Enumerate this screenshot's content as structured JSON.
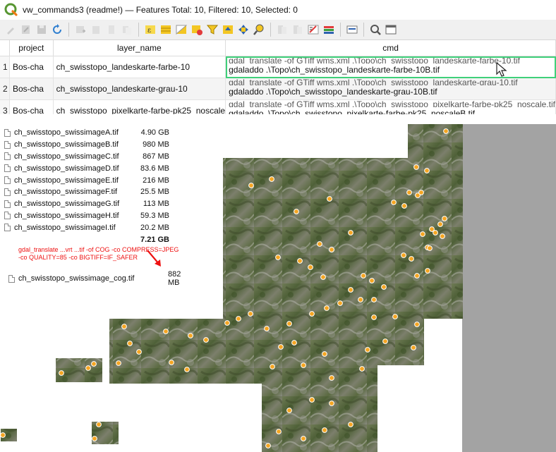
{
  "window": {
    "title": "vw_commands3 (readme!) — Features Total: 10, Filtered: 10, Selected: 0"
  },
  "toolbar": {
    "icons": [
      "pencil-icon",
      "multi-edit-icon",
      "save-icon",
      "reload-icon",
      "add-feature-icon",
      "delete-icon",
      "cut-icon",
      "copy-icon",
      "paste-icon",
      "select-expression-icon",
      "select-all-icon",
      "invert-selection-icon",
      "deselect-icon",
      "filter-icon",
      "move-top-icon",
      "pan-map-icon",
      "zoom-map-icon",
      "new-field-icon",
      "delete-field-icon",
      "field-calculator-icon",
      "conditional-format-icon",
      "dock-icon",
      "actions-icon",
      "form-view-icon"
    ]
  },
  "table": {
    "headers": [
      "project",
      "layer_name",
      "cmd"
    ],
    "rows": [
      {
        "num": "1",
        "project": "Bos-cha",
        "layer_name": "ch_swisstopo_landeskarte-farbe-10",
        "cmd_line1": "gdal_translate -of GTiff wms.xml .\\Topo\\ch_swisstopo_landeskarte-farbe-10.tif",
        "cmd_line2": "gdaladdo .\\Topo\\ch_swisstopo_landeskarte-farbe-10B.tif"
      },
      {
        "num": "2",
        "project": "Bos-cha",
        "layer_name": "ch_swisstopo_landeskarte-grau-10",
        "cmd_line1": "gdal_translate -of GTiff wms.xml .\\Topo\\ch_swisstopo_landeskarte-grau-10.tif",
        "cmd_line2": "gdaladdo .\\Topo\\ch_swisstopo_landeskarte-grau-10B.tif"
      },
      {
        "num": "3",
        "project": "Bos-cha",
        "layer_name": "ch_swisstopo_pixelkarte-farbe-pk25_noscale",
        "cmd_line1": "gdal_translate -of GTiff wms.xml .\\Topo\\ch_swisstopo_pixelkarte-farbe-pk25_noscale.tif",
        "cmd_line2": "gdaladdo .\\Topo\\ch_swisstopo_pixelkarte-farbe-pk25_noscaleB.tif"
      }
    ]
  },
  "files": [
    {
      "name": "ch_swisstopo_swissimageA.tif",
      "size": "4.90 GB"
    },
    {
      "name": "ch_swisstopo_swissimageB.tif",
      "size": "980 MB"
    },
    {
      "name": "ch_swisstopo_swissimageC.tif",
      "size": "867 MB"
    },
    {
      "name": "ch_swisstopo_swissimageD.tif",
      "size": "83.6 MB"
    },
    {
      "name": "ch_swisstopo_swissimageE.tif",
      "size": "216 MB"
    },
    {
      "name": "ch_swisstopo_swissimageF.tif",
      "size": "25.5 MB"
    },
    {
      "name": "ch_swisstopo_swissimageG.tif",
      "size": "113 MB"
    },
    {
      "name": "ch_swisstopo_swissimageH.tif",
      "size": "59.3 MB"
    },
    {
      "name": "ch_swisstopo_swissimageI.tif",
      "size": "20.2 MB"
    }
  ],
  "files_total": "7.21 GB",
  "command_note": {
    "line1": "gdal_translate ...vrt ...tif -of COG -co COMPRESS=JPEG",
    "line2": "-co QUALITY=85 -co BIGTIFF=IF_SAFER"
  },
  "cog_file": {
    "name": "ch_swisstopo_swissimage_cog.tif",
    "size": "882 MB"
  },
  "colors": {
    "selection_outline": "#3fd07a",
    "annotation_red": "#ee1111",
    "marker_fill": "#f5a623",
    "map_gray": "#a3a3a3"
  }
}
